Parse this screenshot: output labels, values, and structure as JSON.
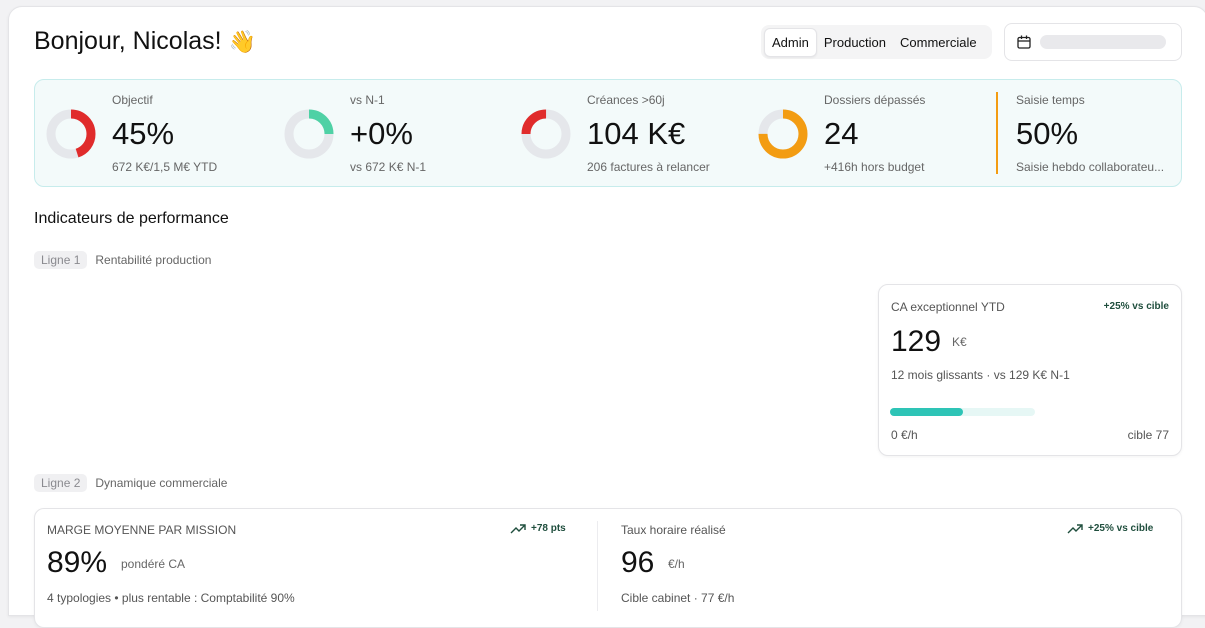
{
  "header": {
    "greeting": "Bonjour, Nicolas!",
    "wave_emoji": "👋",
    "tabs": [
      {
        "label": "Admin",
        "active": true
      },
      {
        "label": "Production",
        "active": false
      },
      {
        "label": "Commerciale",
        "active": false
      }
    ],
    "date_icon": "calendar-icon"
  },
  "kpis": [
    {
      "label": "Objectif",
      "value": "45%",
      "sub": "672 K€/1,5 M€ YTD",
      "color": "#e02b2b",
      "progress": 0.45
    },
    {
      "label": "vs N-1",
      "value": "+0%",
      "sub": "vs 672 K€ N-1",
      "color": "#4fd1a5",
      "progress": 0.25
    },
    {
      "label": "Créances >60j",
      "value": "104 K€",
      "sub": "206 factures à relancer",
      "color": "#e02b2b",
      "progress": 0.25
    },
    {
      "label": "Dossiers dépassés",
      "value": "24",
      "sub": "+416h hors budget",
      "color": "#f39c12",
      "progress": 0.75
    },
    {
      "label": "Saisie temps",
      "value": "50%",
      "sub": "Saisie hebdo collaborateu...",
      "color": "#f39c12"
    }
  ],
  "section_title": "Indicateurs de performance",
  "line1": {
    "tag": "Ligne 1",
    "label": "Rentabilité production"
  },
  "line2": {
    "tag": "Ligne 2",
    "label": "Dynamique commerciale"
  },
  "card_ca": {
    "label": "CA exceptionnel YTD",
    "delta": "+25% vs cible",
    "value": "129",
    "unit": "K€",
    "note": "12 mois glissants · vs 129 K€ N-1",
    "progress_left": "0 €/h",
    "progress_right": "cible 77",
    "progress": 0.5,
    "accent": "#2ec4b6"
  },
  "card_marge": {
    "label": "MARGE MOYENNE PAR MISSION",
    "delta": "+78 pts",
    "value": "89%",
    "unit": "pondéré CA",
    "note": "4 typologies • plus rentable : Comptabilité 90%",
    "trend_icon": "trending-up-icon"
  },
  "card_taux": {
    "label": "Taux horaire réalisé",
    "delta": "+25% vs cible",
    "value": "96",
    "unit": "€/h",
    "note": "Cible cabinet · 77 €/h",
    "trend_icon": "trending-up-icon"
  }
}
